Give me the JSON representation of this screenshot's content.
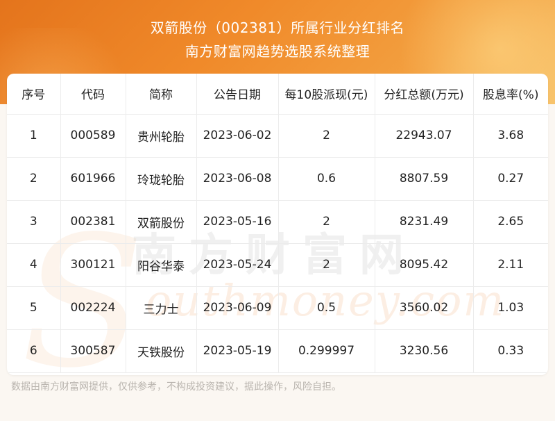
{
  "header": {
    "title_line1": "双箭股份（002381）所属行业分红排名",
    "title_line2": "南方财富网趋势选股系统整理"
  },
  "table": {
    "columns": [
      "序号",
      "代码",
      "简称",
      "公告日期",
      "每10股派现(元)",
      "分红总额(万元)",
      "股息率(%)"
    ],
    "rows": [
      [
        "1",
        "000589",
        "贵州轮胎",
        "2023-06-02",
        "2",
        "22943.07",
        "3.68"
      ],
      [
        "2",
        "601966",
        "玲珑轮胎",
        "2023-06-08",
        "0.6",
        "8807.59",
        "0.27"
      ],
      [
        "3",
        "002381",
        "双箭股份",
        "2023-05-16",
        "2",
        "8231.49",
        "2.65"
      ],
      [
        "4",
        "300121",
        "阳谷华泰",
        "2023-05-24",
        "2",
        "8095.42",
        "2.11"
      ],
      [
        "5",
        "002224",
        "三力士",
        "2023-06-09",
        "0.5",
        "3560.02",
        "1.03"
      ],
      [
        "6",
        "300587",
        "天铁股份",
        "2023-05-19",
        "0.299997",
        "3230.56",
        "0.33"
      ]
    ]
  },
  "watermark": {
    "cn_text": "南方财富网",
    "en_text": "outhmoney.com",
    "s_letter": "S"
  },
  "footer": {
    "disclaimer": "数据由南方财富网提供，仅供参考，不构成投资建议，据此操作，风险自担。"
  },
  "colors": {
    "header_orange": "#f08a2a",
    "header_light": "#f7c067",
    "page_bg": "#fbf7f2"
  }
}
